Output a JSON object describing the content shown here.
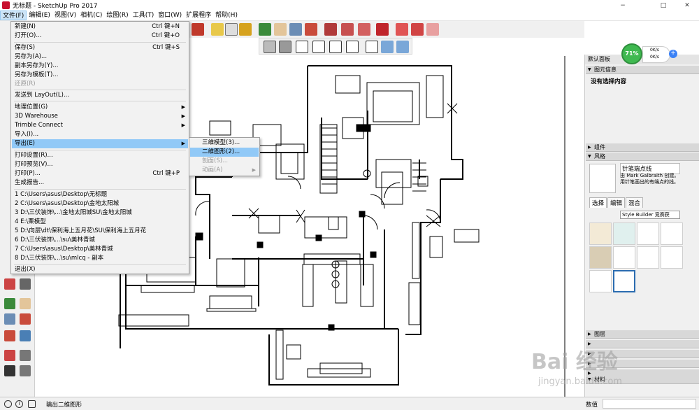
{
  "window": {
    "title": "无标题 - SketchUp Pro 2017",
    "minimize": "−",
    "maximize": "□",
    "close": "✕"
  },
  "menubar": {
    "items": [
      "文件(F)",
      "编辑(E)",
      "视图(V)",
      "相机(C)",
      "绘图(R)",
      "工具(T)",
      "窗口(W)",
      "扩展程序",
      "帮助(H)"
    ],
    "active": "文件(F)"
  },
  "file_menu": {
    "items": [
      {
        "label": "新建(N)",
        "shortcut": "Ctrl 键+N"
      },
      {
        "label": "打开(O)...",
        "shortcut": "Ctrl 键+O"
      },
      {
        "label": "保存(S)",
        "shortcut": "Ctrl 键+S"
      },
      {
        "label": "另存为(A)...",
        "shortcut": ""
      },
      {
        "label": "副本另存为(Y)...",
        "shortcut": ""
      },
      {
        "label": "另存为模板(T)...",
        "shortcut": ""
      },
      {
        "label": "还原(R)",
        "shortcut": ""
      },
      {
        "label": "发送到 LayOut(L)...",
        "shortcut": ""
      },
      {
        "label": "地理位置(G)",
        "shortcut": ""
      },
      {
        "label": "3D Warehouse",
        "shortcut": ""
      },
      {
        "label": "Trimble Connect",
        "shortcut": ""
      },
      {
        "label": "导入(I)...",
        "shortcut": ""
      },
      {
        "label": "导出(E)",
        "shortcut": ""
      },
      {
        "label": "打印设置(R)...",
        "shortcut": ""
      },
      {
        "label": "打印预览(V)...",
        "shortcut": ""
      },
      {
        "label": "打印(P)...",
        "shortcut": "Ctrl 键+P"
      },
      {
        "label": "生成报告...",
        "shortcut": ""
      },
      {
        "label": "1 C:\\Users\\asus\\Desktop\\无标题",
        "shortcut": ""
      },
      {
        "label": "2 C:\\Users\\asus\\Desktop\\金地太阳城",
        "shortcut": ""
      },
      {
        "label": "3 D:\\三伏装饰\\...\\金地太阳城SU\\金地太阳城",
        "shortcut": ""
      },
      {
        "label": "4 E:\\栗模型",
        "shortcut": ""
      },
      {
        "label": "5 D:\\向层\\dt\\保利海上五月花\\SU\\保利海上五月花",
        "shortcut": ""
      },
      {
        "label": "6 D:\\三伏装饰\\...\\su\\美林青城",
        "shortcut": ""
      },
      {
        "label": "7 C:\\Users\\asus\\Desktop\\美林青城",
        "shortcut": ""
      },
      {
        "label": "8 D:\\三伏装饰\\...\\su\\mlcq - 副本",
        "shortcut": ""
      },
      {
        "label": "退出(X)",
        "shortcut": ""
      }
    ]
  },
  "export_submenu": {
    "items": [
      "三维模型(3)...",
      "二维图形(2)...",
      "剖面(S)...",
      "动画(A)"
    ]
  },
  "tray": {
    "title": "默认面板",
    "panels": {
      "entity_info": "图元信息",
      "no_selection": "没有选择内容",
      "components": "组件",
      "styles": "风格",
      "layers": "图层",
      "materials": "材料"
    },
    "style_name": "针笔端点线",
    "style_desc": "由 Mark Galbraith 创建。用针笔画出的有端点的线。",
    "style_tabs": [
      "选择",
      "编辑",
      "混合"
    ],
    "style_select": "Style Builder 竞赛获"
  },
  "perf_widget": {
    "percent": "71%",
    "up": "0K/s",
    "down": "0K/s",
    "plus": "+"
  },
  "status": {
    "message": "输出二维图形",
    "value_label": "数值",
    "info_icon": "i"
  },
  "watermark": {
    "brand": "Bai 经验",
    "url": "jingyan.baidu.com"
  },
  "colors": {
    "menu_highlight": "#91c9f7",
    "perf_green": "#3fb950",
    "brand_red": "#c8102e"
  }
}
